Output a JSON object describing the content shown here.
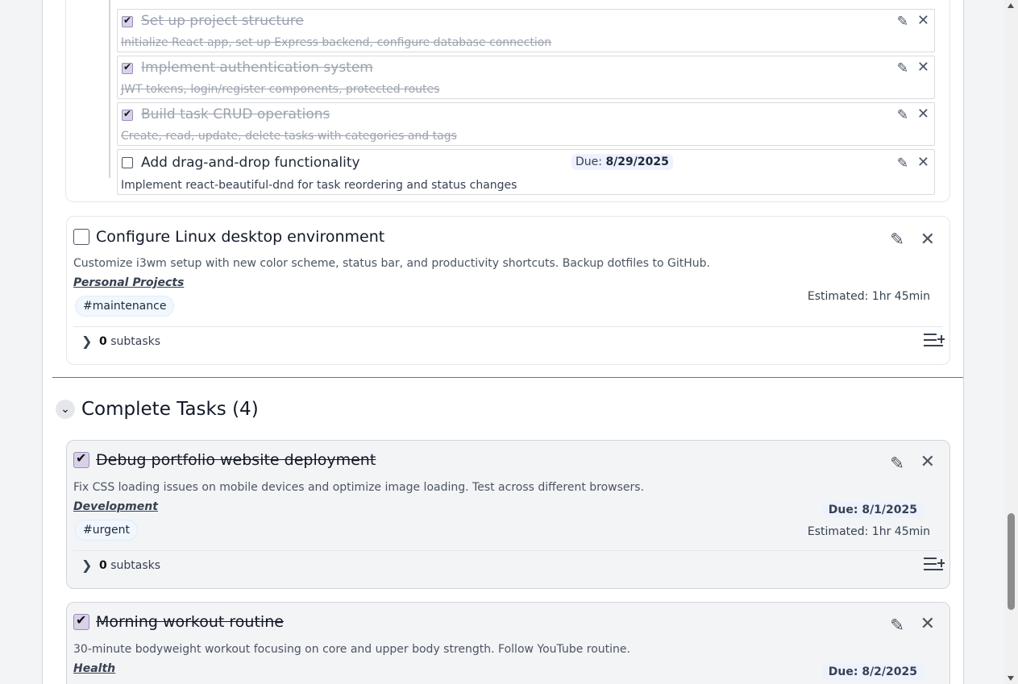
{
  "subtasks": [
    {
      "title": "Set up project structure",
      "desc": "Initialize React app, set up Express backend, configure database connection",
      "done": true
    },
    {
      "title": "Implement authentication system",
      "desc": "JWT tokens, login/register components, protected routes",
      "done": true
    },
    {
      "title": "Build task CRUD operations",
      "desc": "Create, read, update, delete tasks with categories and tags",
      "done": true
    },
    {
      "title": "Add drag-and-drop functionality",
      "desc": "Implement react-beautiful-dnd for task reordering and status changes",
      "done": false,
      "due_label": "Due:",
      "due_value": "8/29/2025"
    }
  ],
  "task_linux": {
    "title": "Configure Linux desktop environment",
    "desc": "Customize i3wm setup with new color scheme, status bar, and productivity shortcuts. Backup dotfiles to GitHub.",
    "category": "Personal Projects",
    "tag": "#maintenance",
    "estimate": "Estimated: 1hr 45min",
    "subtask_count": "0",
    "subtask_label": "subtasks"
  },
  "complete_section": {
    "title": "Complete Tasks (4)"
  },
  "task_debug": {
    "title": "Debug portfolio website deployment",
    "desc": "Fix CSS loading issues on mobile devices and optimize image loading. Test across different browsers.",
    "category": "Development",
    "tag": "#urgent",
    "due": "Due: 8/1/2025",
    "estimate": "Estimated: 1hr 45min",
    "subtask_count": "0",
    "subtask_label": "subtasks"
  },
  "task_workout": {
    "title": "Morning workout routine",
    "desc": "30-minute bodyweight workout focusing on core and upper body strength. Follow YouTube routine.",
    "category": "Health",
    "due": "Due: 8/2/2025"
  },
  "icons": {
    "edit": "pencil-icon",
    "delete": "close-icon",
    "expand": "chevron-right-icon",
    "collapse": "chevron-down-icon",
    "add_subtask": "list-add-icon"
  },
  "colors": {
    "checked_box": "#d8d1e8",
    "complete_card_bg": "#f3f4f6",
    "due_badge_bg": "#eef2ff",
    "tag_bg": "#f0f7ff"
  }
}
